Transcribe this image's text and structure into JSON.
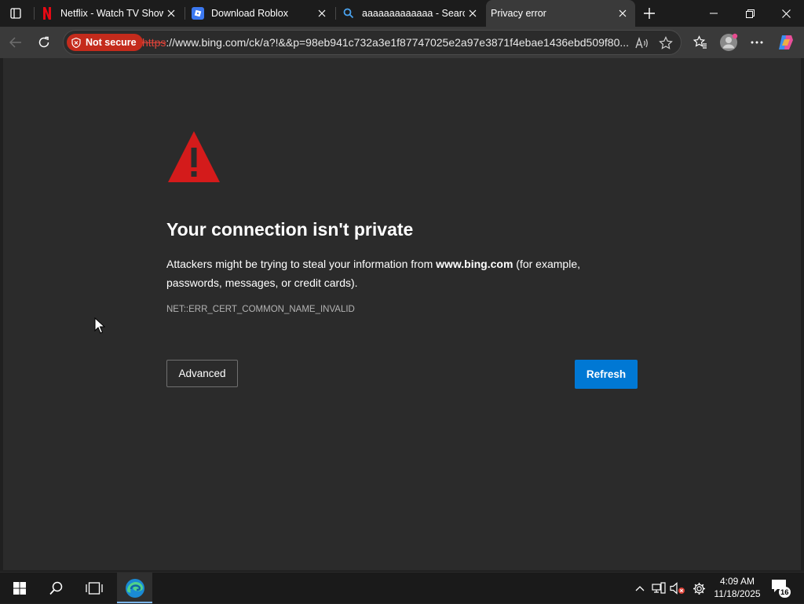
{
  "colors": {
    "accent": "#0078d4",
    "not_secure_red": "#c42b1c",
    "warning_red": "#d41b1b",
    "page_bg": "#2b2b2b"
  },
  "tabs": [
    {
      "title": "Netflix - Watch TV Shows Online",
      "icon": "netflix-icon",
      "active": false
    },
    {
      "title": "Download Roblox",
      "icon": "roblox-icon",
      "active": false
    },
    {
      "title": "aaaaaaaaaaaaa - Search",
      "icon": "search-icon",
      "active": false
    },
    {
      "title": "Privacy error",
      "icon": "none",
      "active": true
    }
  ],
  "toolbar": {
    "security_label": "Not secure",
    "url_scheme": "https",
    "url_rest": "://www.bing.com/ck/a?!&&p=98eb941c732a3e1f87747025e2a97e3871f4ebae1436ebd509f80..."
  },
  "page": {
    "heading": "Your connection isn't private",
    "desc_before": "Attackers might be trying to steal your information from ",
    "desc_domain": "www.bing.com",
    "desc_after": " (for example, passwords, messages, or credit cards).",
    "error_code": "NET::ERR_CERT_COMMON_NAME_INVALID",
    "advanced_label": "Advanced",
    "refresh_label": "Refresh"
  },
  "taskbar": {
    "time": "4:09 AM",
    "date": "11/18/2025",
    "notification_count": "16"
  }
}
